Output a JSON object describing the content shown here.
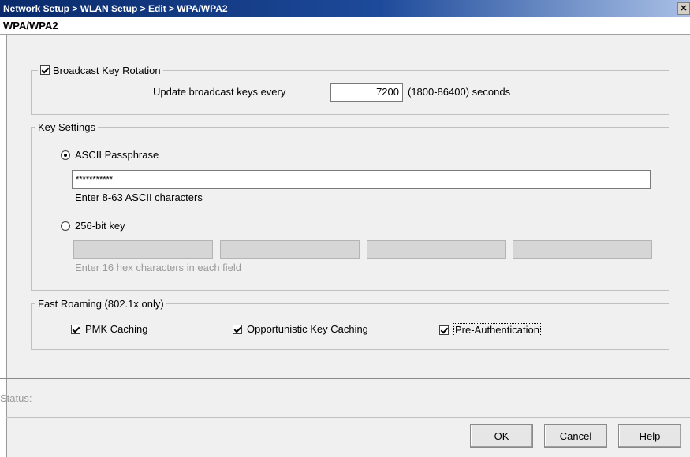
{
  "window": {
    "title": "Network Setup > WLAN Setup > Edit > WPA/WPA2",
    "close_glyph": "✕",
    "subheader": "WPA/WPA2"
  },
  "broadcast_key": {
    "label": "Broadcast Key Rotation",
    "checked": true,
    "update_label": "Update broadcast keys every",
    "value": "7200",
    "range_text": "(1800-86400) seconds"
  },
  "key_settings": {
    "legend": "Key Settings",
    "ascii": {
      "label": "ASCII Passphrase",
      "selected": true,
      "value": "***********",
      "hint": "Enter 8-63 ASCII characters"
    },
    "hex": {
      "label": "256-bit key",
      "selected": false,
      "fields": [
        "",
        "",
        "",
        ""
      ],
      "hint": "Enter 16 hex characters in each field"
    }
  },
  "fast_roaming": {
    "legend": "Fast Roaming (802.1x only)",
    "options": [
      {
        "label": "PMK Caching",
        "checked": true
      },
      {
        "label": "Opportunistic Key Caching",
        "checked": true
      },
      {
        "label": "Pre-Authentication",
        "checked": true
      }
    ]
  },
  "status": {
    "label": "Status:"
  },
  "buttons": {
    "ok": "OK",
    "cancel": "Cancel",
    "help": "Help"
  },
  "colors": {
    "titlebar_start": "#0a2a6b",
    "titlebar_end": "#a9c0e6",
    "panel_bg": "#f0f0f0"
  }
}
